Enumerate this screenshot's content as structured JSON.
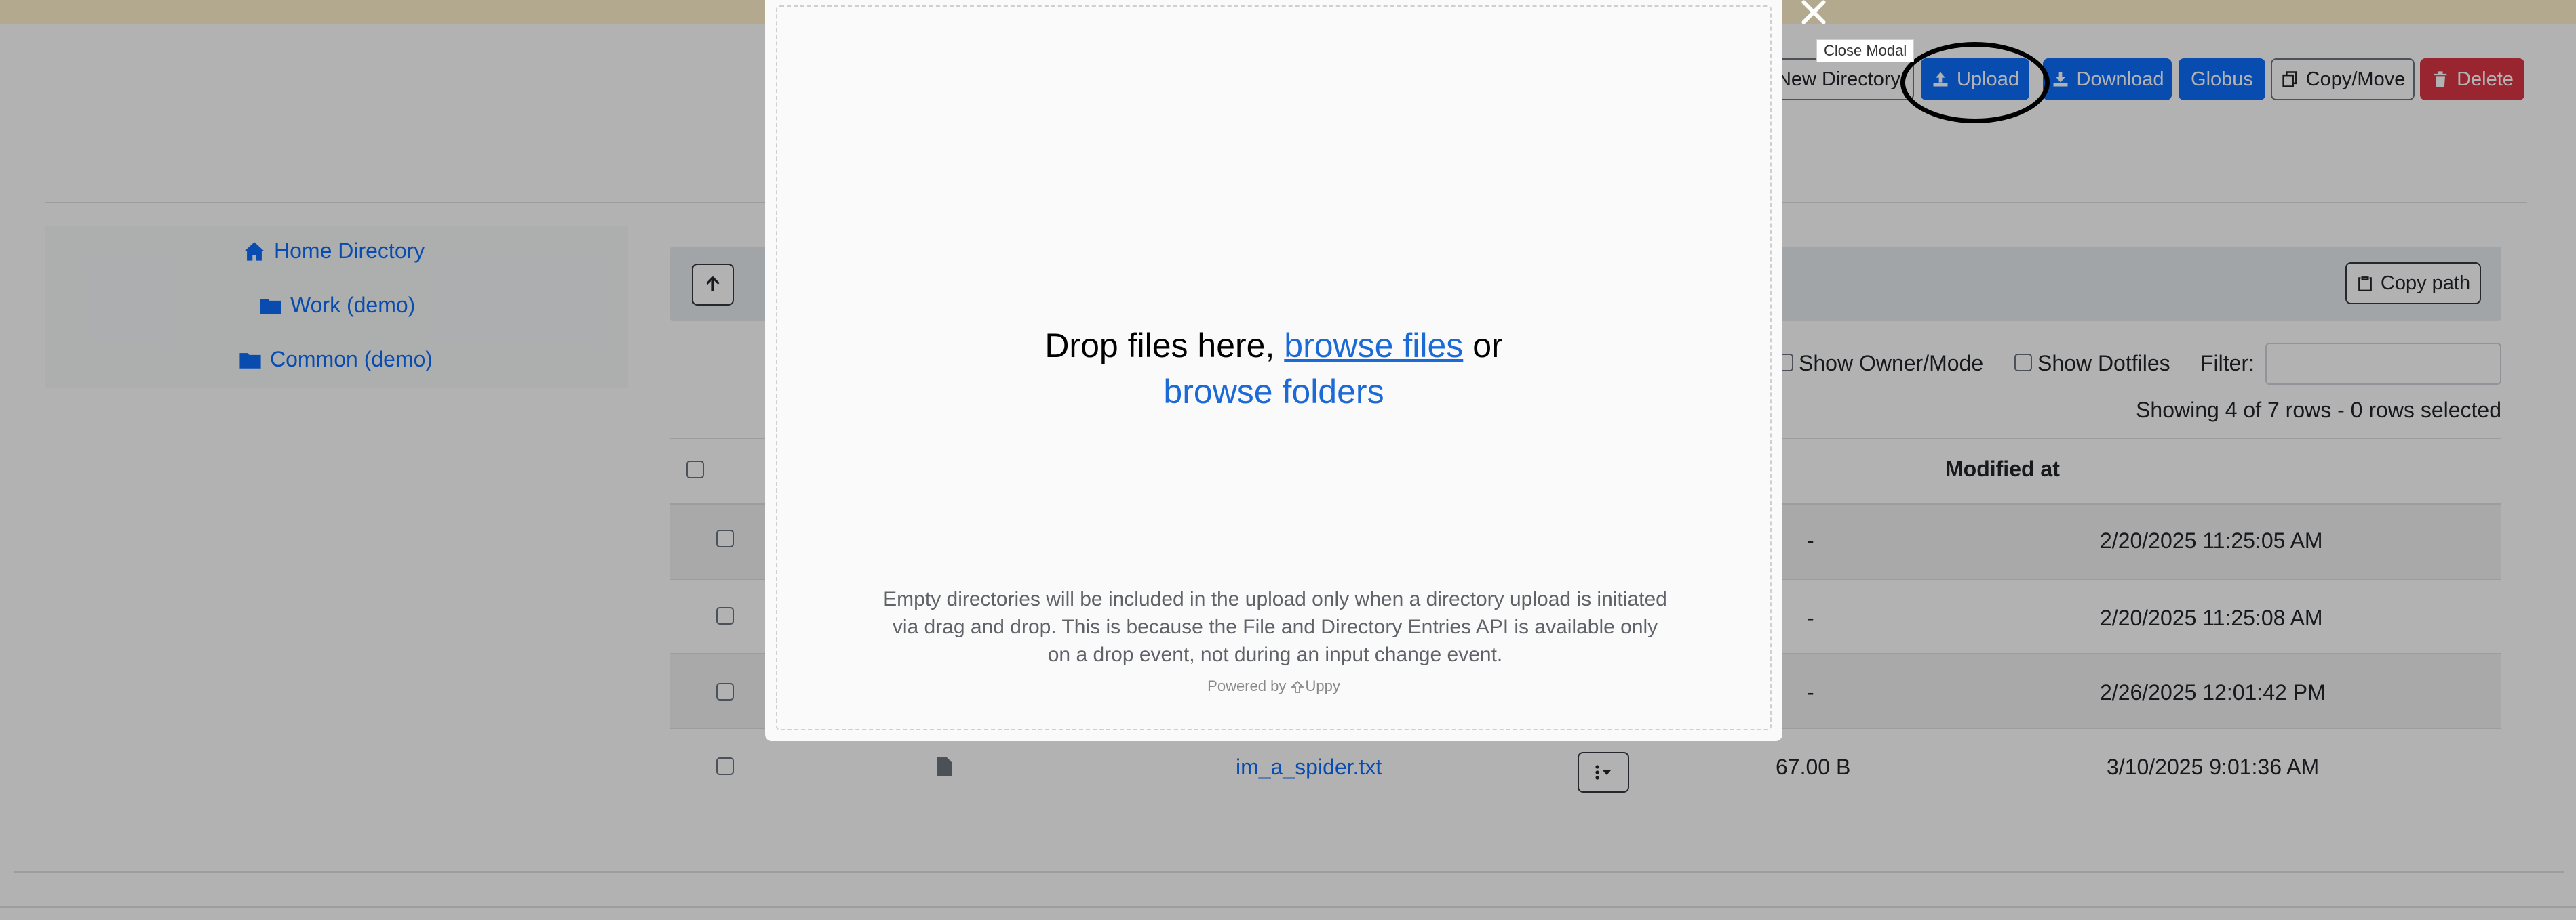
{
  "toolbar": {
    "new_directory": "New Directory",
    "upload": "Upload",
    "download": "Download",
    "globus": "Globus",
    "copy_move": "Copy/Move",
    "delete": "Delete"
  },
  "sidebar": {
    "items": [
      {
        "label": "Home Directory",
        "icon": "home-icon"
      },
      {
        "label": "Work (demo)",
        "icon": "folder-icon"
      },
      {
        "label": "Common (demo)",
        "icon": "folder-icon"
      }
    ]
  },
  "browser": {
    "copy_path": "Copy path",
    "show_owner_mode": "Show Owner/Mode",
    "show_dotfiles": "Show Dotfiles",
    "filter_label": "Filter:",
    "filter_value": "",
    "rows_info": "Showing 4 of 7 rows - 0 rows selected"
  },
  "table": {
    "headers": {
      "modified_at": "Modified at"
    },
    "rows": [
      {
        "name": "",
        "size": "-",
        "modified": "2/20/2025 11:25:05 AM"
      },
      {
        "name": "",
        "size": "-",
        "modified": "2/20/2025 11:25:08 AM"
      },
      {
        "name": "",
        "size": "-",
        "modified": "2/26/2025 12:01:42 PM"
      },
      {
        "name": "im_a_spider.txt",
        "size": "67.00 B",
        "modified": "3/10/2025 9:01:36 AM"
      }
    ]
  },
  "modal": {
    "close_tooltip": "Close Modal",
    "drop_prefix": "Drop files here,",
    "browse_files": "browse files",
    "or": "or",
    "browse_folders": "browse folders",
    "note": "Empty directories will be included in the upload only when a directory upload is initiated via drag and drop. This is because the File and Directory Entries API is available only on a drop event, not during an input change event.",
    "powered_by": "Powered by",
    "brand": "Uppy"
  },
  "colors": {
    "primary": "#0d6efd",
    "danger": "#dc3545",
    "link": "#1b6ad6",
    "alert": "#fff3cd"
  }
}
